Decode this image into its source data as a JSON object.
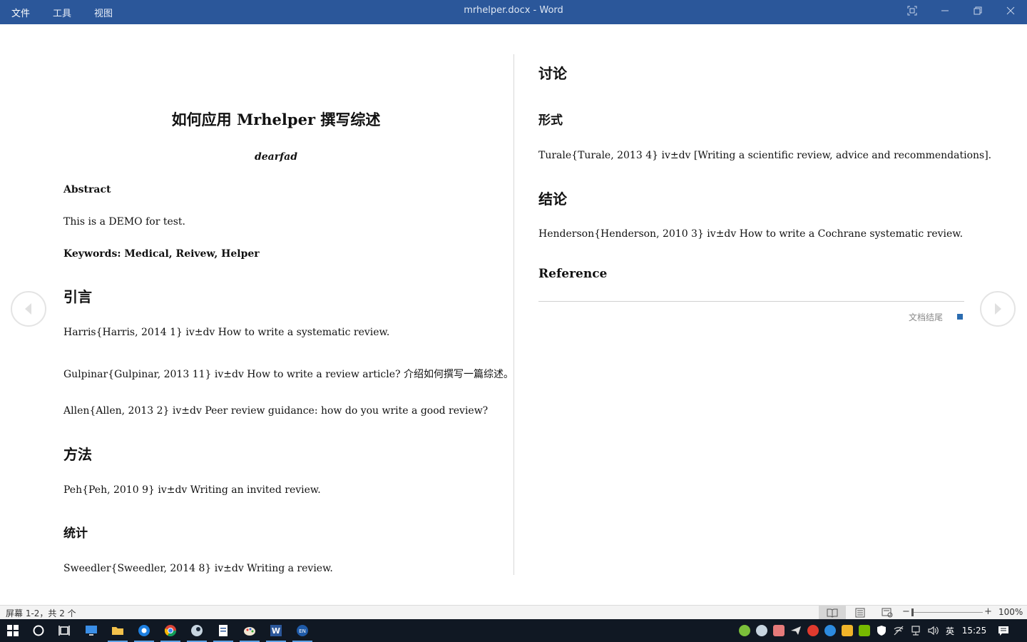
{
  "titlebar": {
    "menu": [
      "文件",
      "工具",
      "视图"
    ],
    "title": "mrhelper.docx  -  Word"
  },
  "document": {
    "title": "如何应用 Mrhelper 撰写综述",
    "author": "dearfad",
    "abstract_heading": "Abstract",
    "abstract_text": "This is a DEMO for test.",
    "keywords": "Keywords: Medical, Reivew, Helper",
    "sections": {
      "intro": {
        "heading": "引言",
        "refs": [
          "Harris{Harris, 2014 1} iv±dv How to write a systematic review.",
          "Gulpinar{Gulpinar, 2013 11} iv±dv How to write a review article?  介绍如何撰写一篇综述。",
          "Allen{Allen, 2013 2} iv±dv Peer review guidance: how do you write a good review?"
        ]
      },
      "methods": {
        "heading": "方法",
        "refs": [
          "Peh{Peh, 2010 9} iv±dv Writing an invited review."
        ]
      },
      "stats": {
        "heading": "统计",
        "refs": [
          "Sweedler{Sweedler, 2014 8} iv±dv Writing a review."
        ]
      },
      "discussion": {
        "heading": "讨论"
      },
      "format": {
        "heading": "形式",
        "refs": [
          "Turale{Turale, 2013 4} iv±dv [Writing a scientific review, advice and recommendations]."
        ]
      },
      "conclusion": {
        "heading": "结论",
        "refs": [
          "Henderson{Henderson, 2010 3} iv±dv How to write a Cochrane systematic review."
        ]
      },
      "reference": {
        "heading": "Reference"
      }
    },
    "end_label": "文档结尾"
  },
  "statusbar": {
    "screen_info": "屏幕 1-2，共 2 个",
    "zoom": "100%",
    "zoom_level_pct": 100
  },
  "taskbar": {
    "time": "15:25",
    "ime": "英"
  }
}
